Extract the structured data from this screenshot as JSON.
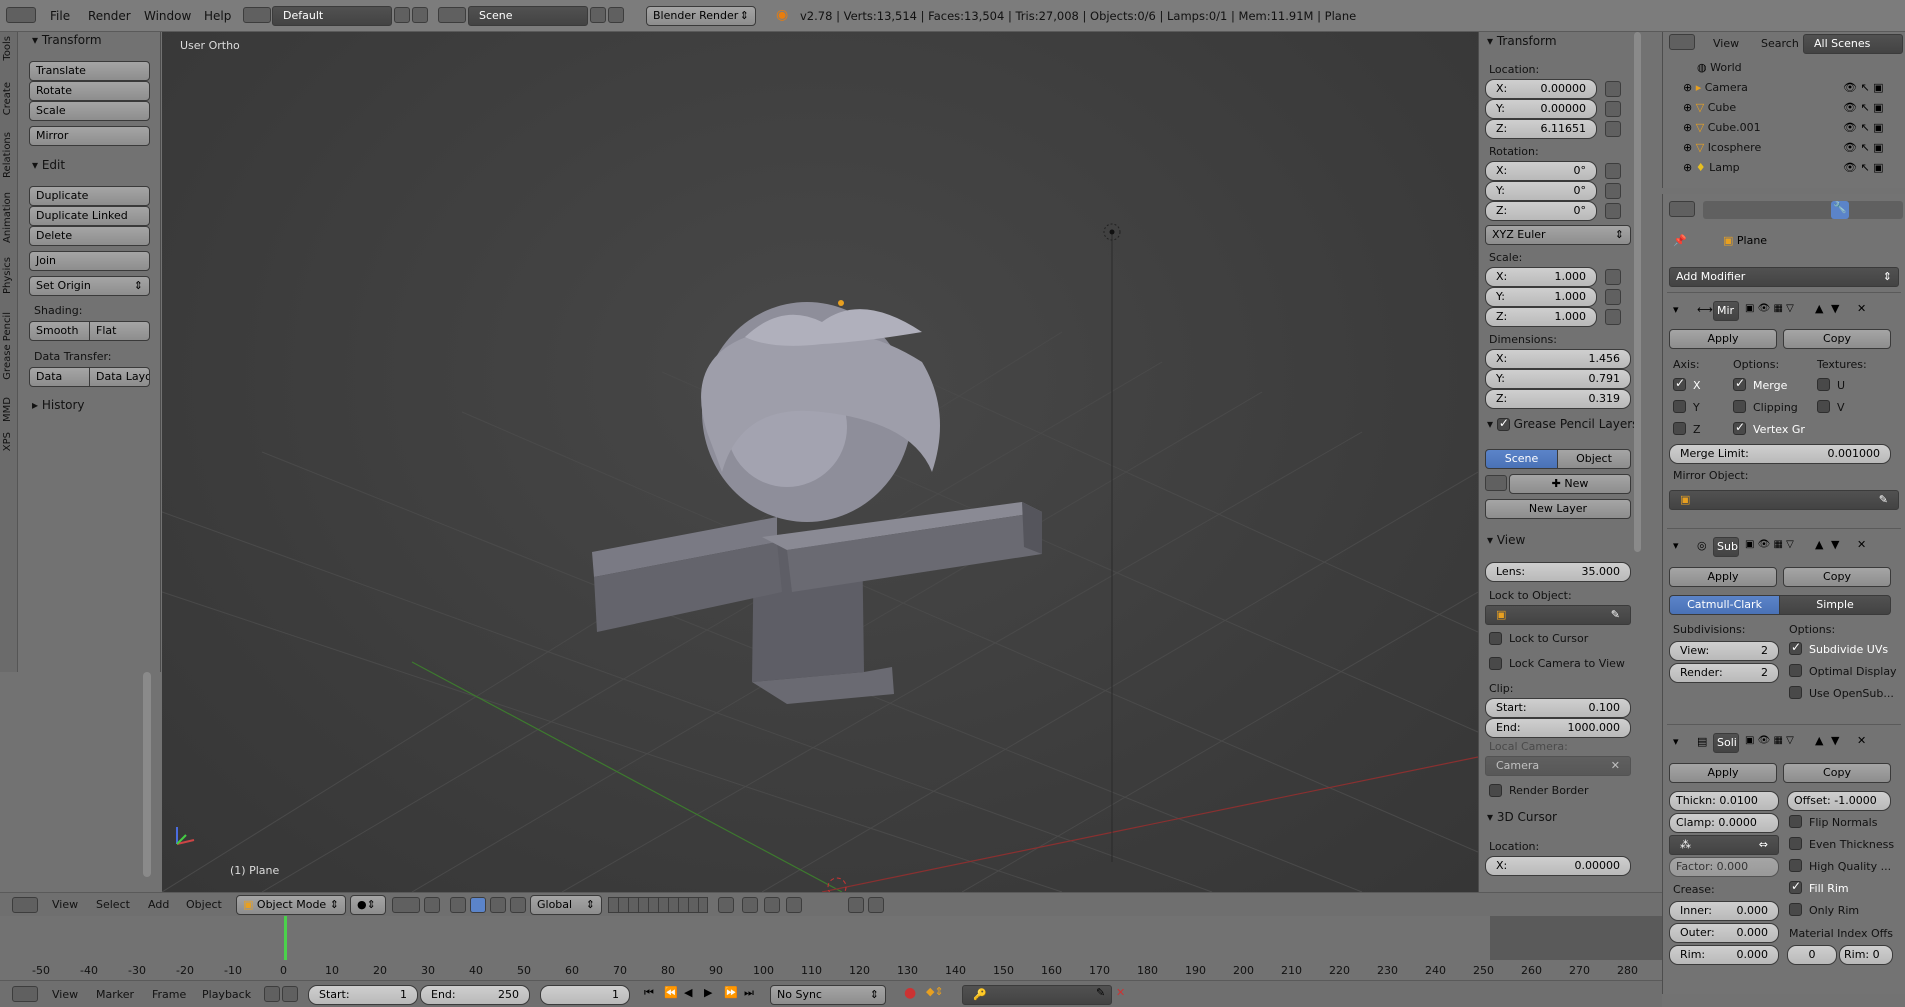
{
  "topbar": {
    "menus": [
      "File",
      "Render",
      "Window",
      "Help"
    ],
    "layout": "Default",
    "scene": "Scene",
    "engine": "Blender Render",
    "stats": "v2.78 | Verts:13,514 | Faces:13,504 | Tris:27,008 | Objects:0/6 | Lamps:0/1 | Mem:11.91M | Plane"
  },
  "tabs": [
    "Tools",
    "Create",
    "Relations",
    "Animation",
    "Physics",
    "Grease Pencil",
    "MMD",
    "XPS"
  ],
  "tools": {
    "transform_header": "Transform",
    "translate": "Translate",
    "rotate": "Rotate",
    "scale": "Scale",
    "mirror": "Mirror",
    "edit_header": "Edit",
    "duplicate": "Duplicate",
    "duplicate_linked": "Duplicate Linked",
    "delete": "Delete",
    "join": "Join",
    "set_origin": "Set Origin",
    "shading_label": "Shading:",
    "smooth": "Smooth",
    "flat": "Flat",
    "data_transfer_label": "Data Transfer:",
    "data": "Data",
    "data_layo": "Data Layo",
    "history_header": "History"
  },
  "viewport": {
    "view_label": "User Ortho",
    "object_label": "(1) Plane"
  },
  "npanel": {
    "transform_header": "Transform",
    "location_label": "Location:",
    "location": [
      {
        "axis": "X:",
        "value": "0.00000"
      },
      {
        "axis": "Y:",
        "value": "0.00000"
      },
      {
        "axis": "Z:",
        "value": "6.11651"
      }
    ],
    "rotation_label": "Rotation:",
    "rotation": [
      {
        "axis": "X:",
        "value": "0°"
      },
      {
        "axis": "Y:",
        "value": "0°"
      },
      {
        "axis": "Z:",
        "value": "0°"
      }
    ],
    "rotation_mode": "XYZ Euler",
    "scale_label": "Scale:",
    "scale": [
      {
        "axis": "X:",
        "value": "1.000"
      },
      {
        "axis": "Y:",
        "value": "1.000"
      },
      {
        "axis": "Z:",
        "value": "1.000"
      }
    ],
    "dimensions_label": "Dimensions:",
    "dimensions": [
      {
        "axis": "X:",
        "value": "1.456"
      },
      {
        "axis": "Y:",
        "value": "0.791"
      },
      {
        "axis": "Z:",
        "value": "0.319"
      }
    ],
    "grease_header": "Grease Pencil Layers",
    "gp_scene": "Scene",
    "gp_object": "Object",
    "gp_new": "New",
    "gp_new_layer": "New Layer",
    "view_header": "View",
    "lens_label": "Lens:",
    "lens_value": "35.000",
    "lock_object_label": "Lock to Object:",
    "lock_cursor": "Lock to Cursor",
    "lock_camera": "Lock Camera to View",
    "clip_label": "Clip:",
    "clip_start_label": "Start:",
    "clip_start": "0.100",
    "clip_end_label": "End:",
    "clip_end": "1000.000",
    "local_camera_label": "Local Camera:",
    "local_camera": "Camera",
    "render_border": "Render Border",
    "cursor_header": "3D Cursor",
    "cursor_location_label": "Location:",
    "cursor_x_label": "X:",
    "cursor_x": "0.00000"
  },
  "outliner": {
    "menus": [
      "View",
      "Search"
    ],
    "scope": "All Scenes",
    "items": [
      "World",
      "Camera",
      "Cube",
      "Cube.001",
      "Icosphere",
      "Lamp"
    ]
  },
  "props": {
    "object_name": "Plane",
    "add_modifier": "Add Modifier",
    "mirror": {
      "name": "Mir",
      "apply": "Apply",
      "copy": "Copy",
      "axis_label": "Axis:",
      "options_label": "Options:",
      "textures_label": "Textures:",
      "axes": [
        "X",
        "Y",
        "Z"
      ],
      "options": [
        "Merge",
        "Clipping",
        "Vertex Gr"
      ],
      "textures": [
        "U",
        "V"
      ],
      "merge_limit_label": "Merge Limit:",
      "merge_limit": "0.001000",
      "mirror_object_label": "Mirror Object:"
    },
    "subsurf": {
      "name": "Sub",
      "apply": "Apply",
      "copy": "Copy",
      "catmull": "Catmull-Clark",
      "simple": "Simple",
      "subdivisions_label": "Subdivisions:",
      "options_label": "Options:",
      "view_label": "View:",
      "view_value": "2",
      "render_label": "Render:",
      "render_value": "2",
      "opt1": "Subdivide UVs",
      "opt2": "Optimal Display",
      "opt3": "Use OpenSub..."
    },
    "solidify": {
      "name": "Soli",
      "apply": "Apply",
      "copy": "Copy",
      "thickness": "Thickn: 0.0100",
      "offset": "Offset: -1.0000",
      "clamp": "Clamp: 0.0000",
      "factor": "Factor:  0.000",
      "crease_label": "Crease:",
      "inner_label": "Inner:",
      "inner": "0.000",
      "outer_label": "Outer:",
      "outer": "0.000",
      "rim_label": "Rim:",
      "rim": "0.000",
      "flip_normals": "Flip Normals",
      "even_thickness": "Even Thickness",
      "high_quality": "High Quality ...",
      "fill_rim": "Fill Rim",
      "only_rim": "Only Rim",
      "material_offset": "Material Index Offs",
      "mat_offset_value": "0",
      "rim_offset": "Rim: 0"
    }
  },
  "vheader": {
    "menus": [
      "View",
      "Select",
      "Add",
      "Object"
    ],
    "mode": "Object Mode",
    "orientation": "Global"
  },
  "timeline": {
    "ticks": [
      "-50",
      "-40",
      "-30",
      "-20",
      "-10",
      "0",
      "10",
      "20",
      "30",
      "40",
      "50",
      "60",
      "70",
      "80",
      "90",
      "100",
      "110",
      "120",
      "130",
      "140",
      "150",
      "160",
      "170",
      "180",
      "190",
      "200",
      "210",
      "220",
      "230",
      "240",
      "250",
      "260",
      "270",
      "280"
    ],
    "menus": [
      "View",
      "Marker",
      "Frame",
      "Playback"
    ],
    "start_label": "Start:",
    "start": "1",
    "end_label": "End:",
    "end": "250",
    "current": "1",
    "sync": "No Sync"
  }
}
